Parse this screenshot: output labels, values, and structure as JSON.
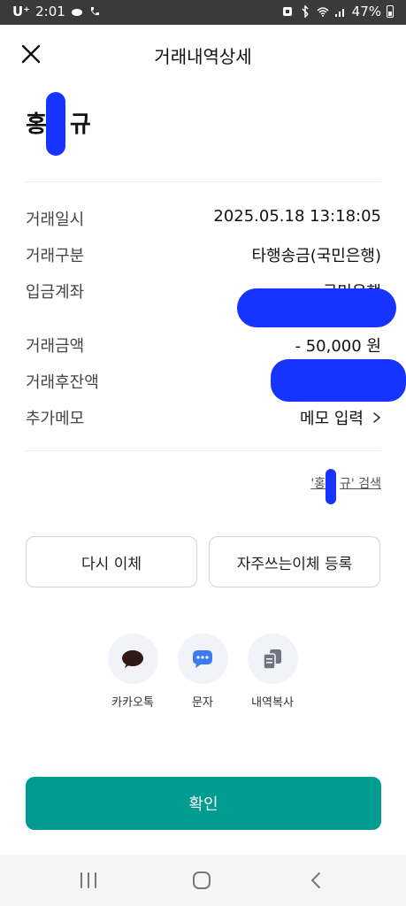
{
  "status_bar": {
    "carrier": "U⁺",
    "time": "2:01",
    "battery": "47%"
  },
  "header": {
    "title": "거래내역상세"
  },
  "recipient": {
    "name_first": "홍",
    "name_last": "규"
  },
  "details": {
    "date_label": "거래일시",
    "date_value": "2025.05.18 13:18:05",
    "type_label": "거래구분",
    "type_value": "타행송금(국민은행)",
    "account_label": "입금계좌",
    "account_value": "국민은행",
    "amount_label": "거래금액",
    "amount_value": "- 50,000 원",
    "balance_label": "거래후잔액",
    "memo_label": "추가메모",
    "memo_value": "메모 입력"
  },
  "search": {
    "prefix": "'홍",
    "suffix": "규' 검색"
  },
  "buttons": {
    "retransfer": "다시 이체",
    "favorite": "자주쓰는이체 등록",
    "confirm": "확인"
  },
  "share": {
    "kakao": "카카오톡",
    "sms": "문자",
    "copy": "내역복사"
  },
  "colors": {
    "accent": "#009b91",
    "status_bar": "#3a3a3a",
    "redaction": "#1633ff"
  },
  "icons": {
    "close": "close-icon",
    "chevron": "chevron-right-icon",
    "kakao": "speech-bubble-icon",
    "sms": "message-dots-icon",
    "copy": "copy-icon",
    "recents": "recent-apps-icon",
    "home": "home-icon",
    "back": "back-icon"
  }
}
